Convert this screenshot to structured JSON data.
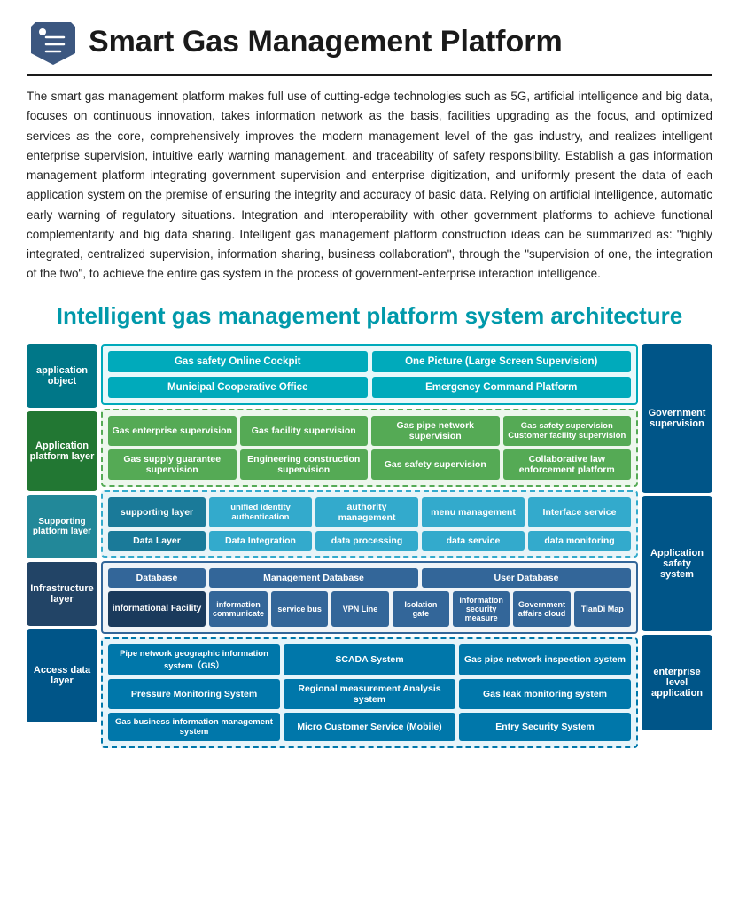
{
  "header": {
    "title": "Smart Gas Management Platform",
    "tagline": "Intelligent gas management platform system architecture"
  },
  "description": "The smart gas management platform makes full use of cutting-edge technologies such as 5G, artificial intelligence and big data, focuses on continuous innovation, takes information network as the basis, facilities upgrading as the focus, and optimized services as the core, comprehensively improves the modern management level of the gas industry, and realizes intelligent enterprise supervision, intuitive early warning management, and traceability of safety responsibility. Establish a gas information management platform integrating government supervision and enterprise digitization, and uniformly present the data of each application system on the premise of ensuring the integrity and accuracy of basic data. Relying on artificial intelligence, automatic early warning of regulatory situations. Integration and interoperability with other government platforms to achieve functional complementarity and big data sharing. Intelligent gas management platform construction ideas can be summarized as: \"highly integrated, centralized supervision, information sharing, business collaboration\", through the \"supervision of one, the integration of the two\", to achieve the entire gas system in the process of government-enterprise interaction intelligence.",
  "layers": {
    "app_object": {
      "label": "application object",
      "items": [
        "Gas safety Online Cockpit",
        "One Picture (Large Screen Supervision)",
        "Municipal Cooperative Office",
        "Emergency Command Platform"
      ]
    },
    "app_platform": {
      "label": "Application platform layer",
      "items": [
        "Gas enterprise supervision",
        "Gas facility supervision",
        "Gas pipe network supervision",
        "Gas safety supervision Customer facility supervision",
        "Gas supply guarantee supervision",
        "Engineering construction supervision",
        "Gas safety supervision",
        "Collaborative law enforcement platform"
      ]
    },
    "support": {
      "label": "Supporting platform layer",
      "row1_label": "supporting layer",
      "row2_label": "Data Layer",
      "row1_items": [
        "unified identity authentication",
        "authority management",
        "menu management",
        "Interface service"
      ],
      "row2_items": [
        "Data Integration",
        "data processing",
        "data service",
        "data monitoring"
      ]
    },
    "infra": {
      "label": "Infrastructure layer",
      "row1": [
        "Database",
        "Management Database",
        "User Database"
      ],
      "row2_label": "informational Facility",
      "row2_items": [
        "information communicate",
        "service bus",
        "VPN Line",
        "Isolation gate",
        "information security measure",
        "Government affairs cloud",
        "TianDi Map"
      ]
    },
    "access": {
      "label": "Access data layer",
      "items": [
        "Pipe network geographic information system（GIS）",
        "SCADA System",
        "Gas pipe network inspection system",
        "Pressure Monitoring System",
        "Regional measurement Analysis system",
        "Gas leak monitoring system",
        "Gas business information management system",
        "Micro Customer Service (Mobile)",
        "Entry Security System"
      ]
    }
  },
  "right_labels": {
    "gov": "Government supervision",
    "app_safe": "Application safety system",
    "enterprise": "enterprise level application"
  }
}
